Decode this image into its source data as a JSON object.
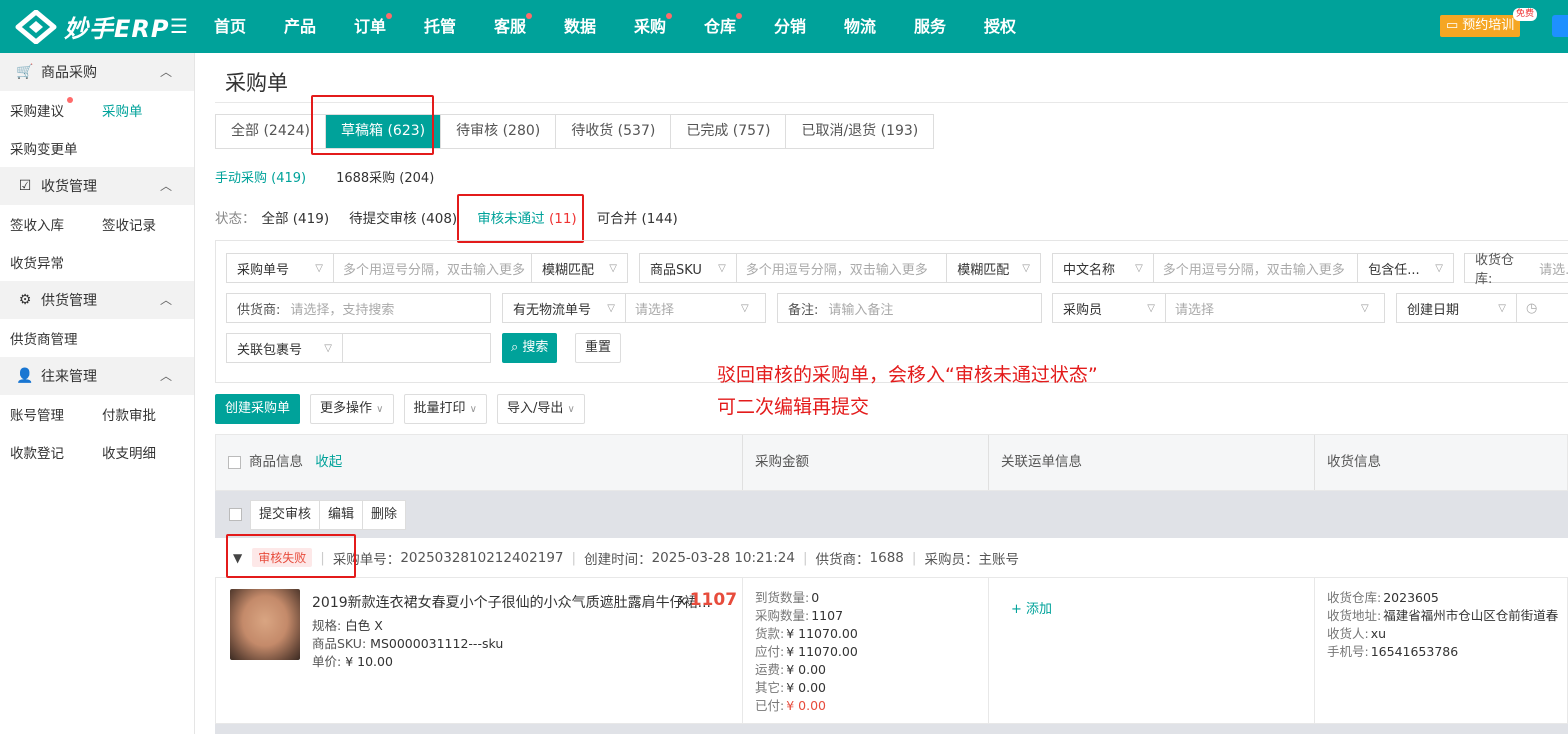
{
  "colors": {
    "brand": "#00a29a",
    "danger": "#e31b1b",
    "badge": "#e74c3c",
    "training": "#f5a623"
  },
  "header": {
    "logo_text": "妙手ERP",
    "nav": [
      {
        "label": "首页",
        "dot": false
      },
      {
        "label": "产品",
        "dot": false
      },
      {
        "label": "订单",
        "dot": true
      },
      {
        "label": "托管",
        "dot": false
      },
      {
        "label": "客服",
        "dot": true
      },
      {
        "label": "数据",
        "dot": false
      },
      {
        "label": "采购",
        "dot": true
      },
      {
        "label": "仓库",
        "dot": true
      },
      {
        "label": "分销",
        "dot": false
      },
      {
        "label": "物流",
        "dot": false
      },
      {
        "label": "服务",
        "dot": false
      },
      {
        "label": "授权",
        "dot": false
      }
    ],
    "training_label": "预约培训",
    "free_badge": "免费"
  },
  "sidebar": {
    "sec1": {
      "title": "商品采购",
      "icon": "cart-icon"
    },
    "sec1_items": [
      [
        "采购建议",
        "采购单"
      ],
      [
        "采购变更单",
        ""
      ]
    ],
    "sec2": {
      "title": "收货管理",
      "icon": "clipboard-icon"
    },
    "sec2_items": [
      [
        "签收入库",
        "签收记录"
      ],
      [
        "收货异常",
        ""
      ]
    ],
    "sec3": {
      "title": "供货管理",
      "icon": "supplier-icon"
    },
    "sec3_items": [
      [
        "供货商管理",
        ""
      ]
    ],
    "sec4": {
      "title": "往来管理",
      "icon": "user-icon"
    },
    "sec4_items": [
      [
        "账号管理",
        "付款审批"
      ],
      [
        "收款登记",
        "收支明细"
      ]
    ]
  },
  "page": {
    "title": "采购单"
  },
  "tabs": [
    "全部 (2424)",
    "草稿箱 (623)",
    "待审核 (280)",
    "待收货 (537)",
    "已完成 (757)",
    "已取消/退货 (193)"
  ],
  "subtabs": [
    "手动采购 (419)",
    "1688采购 (204)"
  ],
  "status": {
    "label": "状态：",
    "options": [
      "全部 (419)",
      "待提交审核 (408)"
    ],
    "active_name": "审核未通过",
    "active_count": "(11)",
    "last": "可合并 (144)"
  },
  "filters": {
    "po_no": {
      "label": "采购单号",
      "placeholder": "多个用逗号分隔，双击输入更多",
      "match": "模糊匹配"
    },
    "sku": {
      "label": "商品SKU",
      "placeholder": "多个用逗号分隔，双击输入更多",
      "match": "模糊匹配"
    },
    "cn_name": {
      "label": "中文名称",
      "placeholder": "多个用逗号分隔，双击输入更多",
      "match": "包含任..."
    },
    "warehouse": {
      "label": "收货仓库:",
      "placeholder": "请选..."
    },
    "supplier": {
      "label": "供货商:",
      "placeholder": "请选择，支持搜索"
    },
    "tracking": {
      "label": "有无物流单号",
      "placeholder": "请选择"
    },
    "remark": {
      "label": "备注:",
      "placeholder": "请输入备注"
    },
    "buyer": {
      "label": "采购员",
      "placeholder": "请选择"
    },
    "date": {
      "label": "创建日期"
    },
    "pkg": {
      "label": "关联包裹号"
    },
    "search": "搜索",
    "reset": "重置"
  },
  "annotation": {
    "line1": "驳回审核的采购单，会移入“审核未通过状态”",
    "line2": "可二次编辑再提交"
  },
  "actions": [
    "创建采购单",
    "更多操作",
    "批量打印",
    "导入/导出"
  ],
  "table": {
    "headers": {
      "product": "商品信息",
      "collapse": "收起",
      "amount": "采购金额",
      "tracking": "关联运单信息",
      "receiving": "收货信息"
    },
    "group_buttons": [
      "提交审核",
      "编辑",
      "删除"
    ]
  },
  "order": {
    "status_badge": "审核失败",
    "po_label": "采购单号：",
    "po_no": "2025032810212402197",
    "created_label": "创建时间：",
    "created": "2025-03-28 10:21:24",
    "supplier_label": "供货商：",
    "supplier": "1688",
    "buyer_label": "采购员：",
    "buyer": "主账号",
    "product": {
      "name": "2019新款连衣裙女春夏小个子很仙的小众气质遮肚露肩牛仔裙...",
      "qty_prefix": "x",
      "qty": "1107",
      "spec_label": "规格:",
      "spec": "白色 X",
      "sku_label": "商品SKU:",
      "sku": "MS0000031112---sku",
      "price_label": "单价:",
      "price": "¥ 10.00"
    },
    "amounts": [
      {
        "label": "到货数量:",
        "value": "0"
      },
      {
        "label": "采购数量:",
        "value": "1107"
      },
      {
        "label": "货款:",
        "value": "¥ 11070.00"
      },
      {
        "label": "应付:",
        "value": "¥ 11070.00"
      },
      {
        "label": "运费:",
        "value": "¥ 0.00"
      },
      {
        "label": "其它:",
        "value": "¥ 0.00"
      },
      {
        "label": "已付:",
        "value": "¥ 0.00"
      }
    ],
    "add_label": "+ 添加",
    "receiving": [
      {
        "label": "收货仓库:",
        "value": "2023605"
      },
      {
        "label": "收货地址:",
        "value": "福建省福州市仓山区仓前街道春"
      },
      {
        "label": "收货人:",
        "value": "xu"
      },
      {
        "label": "手机号:",
        "value": "16541653786"
      }
    ]
  }
}
